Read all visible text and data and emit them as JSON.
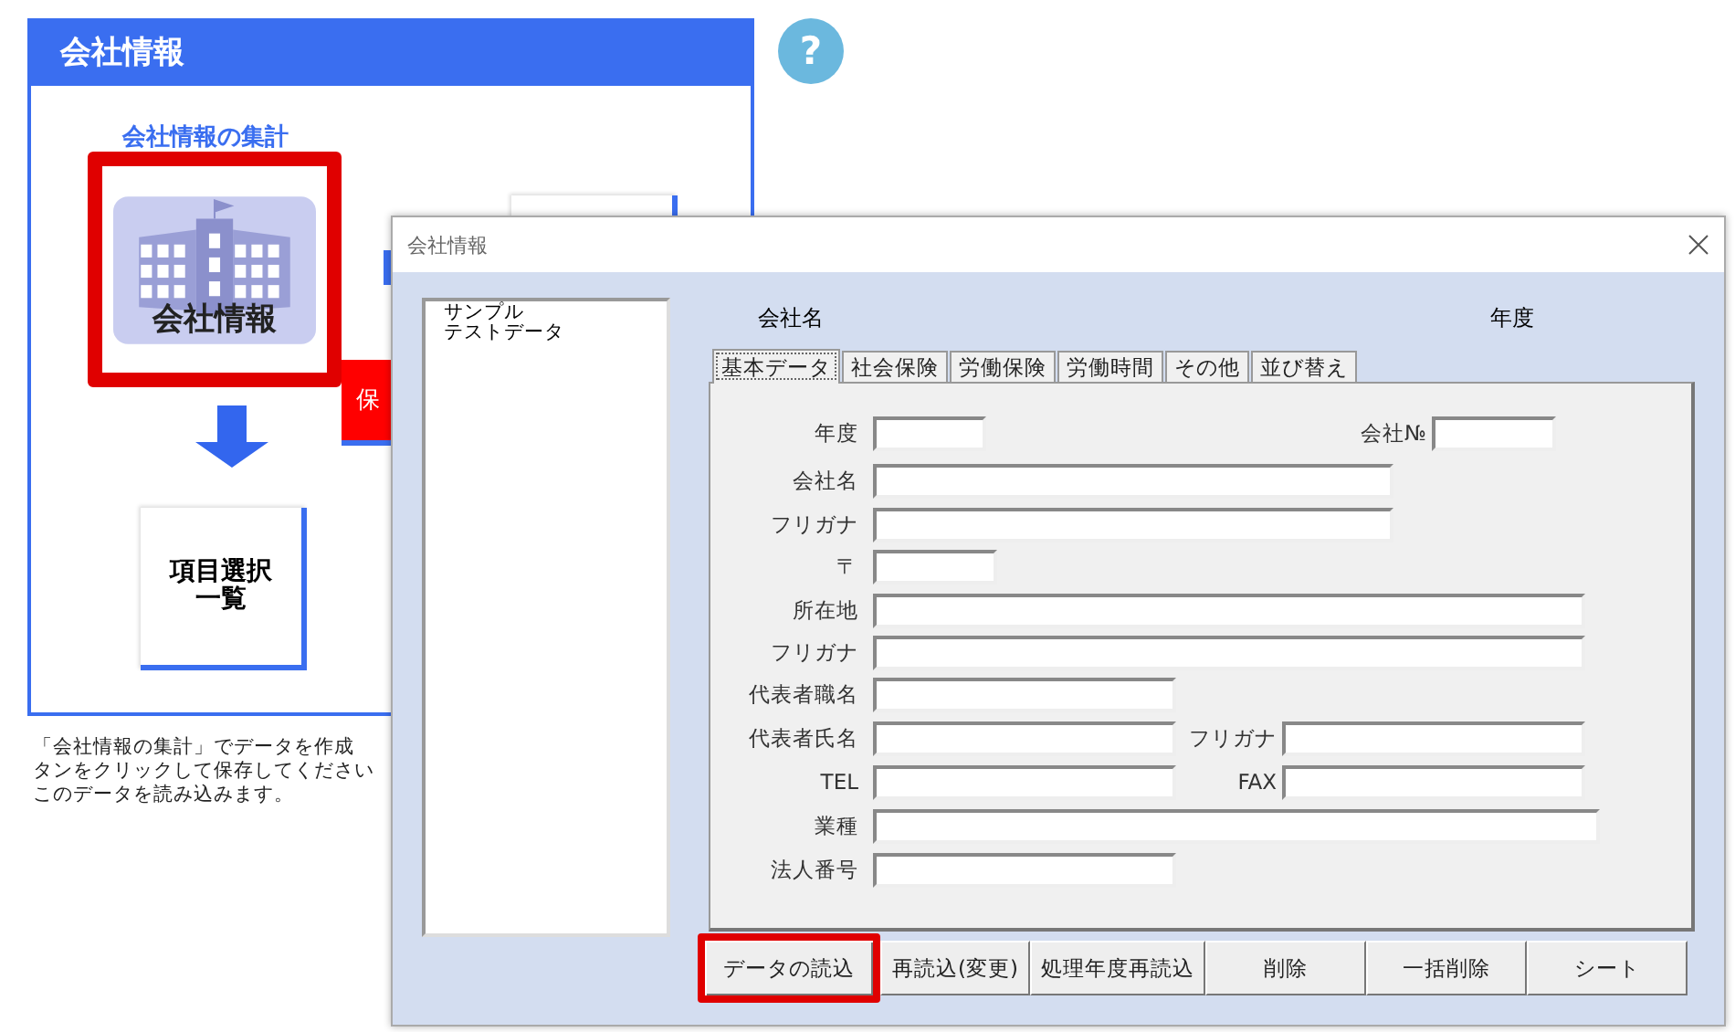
{
  "help_panel": {
    "title": "会社情報",
    "section_title": "会社情報の集計",
    "company_button": {
      "label": "会社情報",
      "highlighted": true
    },
    "save_button": "保",
    "item_box": [
      "項目選択",
      "一覧"
    ],
    "description": [
      "「会社情報の集計」でデータを作成",
      "タンをクリックして保存してください",
      "このデータを読み込みます。"
    ]
  },
  "help_button": "?",
  "dialog": {
    "title": "会社情報",
    "list": [
      "サンプル",
      "テストデータ"
    ],
    "header": {
      "company_label": "会社名",
      "year_label": "年度"
    },
    "tabs": [
      {
        "label": "基本データ",
        "selected": true
      },
      {
        "label": "社会保険",
        "selected": false
      },
      {
        "label": "労働保険",
        "selected": false
      },
      {
        "label": "労働時間",
        "selected": false
      },
      {
        "label": "その他",
        "selected": false
      },
      {
        "label": "並び替え",
        "selected": false
      }
    ],
    "rows": [
      {
        "fields": [
          {
            "label": "年度"
          },
          {
            "label": "会社№"
          }
        ]
      },
      {
        "fields": [
          {
            "label": "会社名"
          }
        ]
      },
      {
        "fields": [
          {
            "label": "フリガナ"
          }
        ]
      },
      {
        "fields": [
          {
            "label": "〒"
          }
        ]
      },
      {
        "fields": [
          {
            "label": "所在地"
          }
        ]
      },
      {
        "fields": [
          {
            "label": "フリガナ"
          }
        ]
      },
      {
        "fields": [
          {
            "label": "代表者職名"
          }
        ]
      },
      {
        "fields": [
          {
            "label": "代表者氏名"
          },
          {
            "label": "フリガナ"
          }
        ]
      },
      {
        "fields": [
          {
            "label": "TEL"
          },
          {
            "label": "FAX"
          }
        ]
      },
      {
        "fields": [
          {
            "label": "業種"
          }
        ]
      },
      {
        "fields": [
          {
            "label": "法人番号"
          }
        ]
      }
    ],
    "buttons": [
      {
        "label": "データの読込",
        "highlighted": true
      },
      {
        "label": "再読込(変更)",
        "highlighted": false
      },
      {
        "label": "処理年度再読込",
        "highlighted": false
      },
      {
        "label": "削除",
        "highlighted": false
      },
      {
        "label": "一括削除",
        "highlighted": false
      },
      {
        "label": "シート",
        "highlighted": false
      }
    ]
  }
}
